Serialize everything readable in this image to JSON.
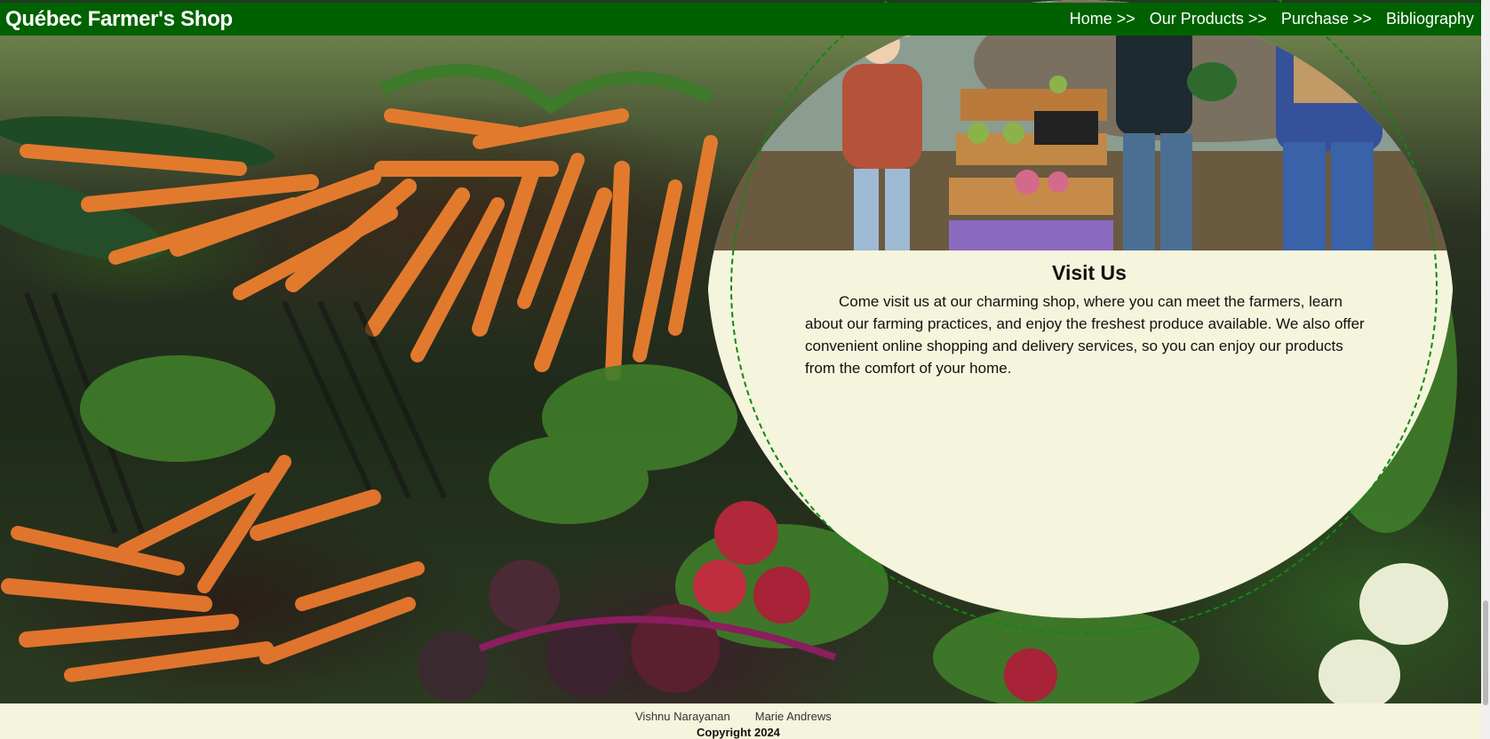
{
  "header": {
    "brand": "Québec Farmer's Shop",
    "nav": [
      {
        "label": "Home >>"
      },
      {
        "label": "Our Products >>"
      },
      {
        "label": "Purchase >>"
      },
      {
        "label": "Bibliography"
      }
    ]
  },
  "main": {
    "background_image": "vegetables-market-photo",
    "feature_image": "farmers-with-produce-cart-photo",
    "visit_title": "Visit Us",
    "visit_text": "Come visit us at our charming shop, where you can meet the farmers, learn about our farming practices, and enjoy the freshest produce available. We also offer convenient online shopping and delivery services, so you can enjoy our products from the comfort of your home."
  },
  "footer": {
    "authors": [
      "Vishnu Narayanan",
      "Marie Andrews"
    ],
    "copyright": "Copyright 2024"
  },
  "colors": {
    "nav_green": "#006100",
    "card_cream": "#f5f4dc",
    "dashed_border": "#118811"
  }
}
